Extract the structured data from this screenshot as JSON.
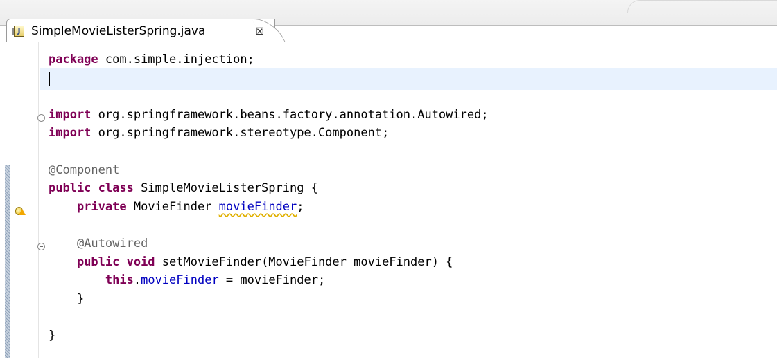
{
  "tab": {
    "file_icon_letter": "J",
    "label": "SimpleMovieListerSpring.java",
    "close_glyph": "⊠"
  },
  "editor": {
    "lines": [
      "package com.simple.injection;",
      "",
      "",
      "import org.springframework.beans.factory.annotation.Autowired;",
      "import org.springframework.stereotype.Component;",
      "",
      "@Component",
      "public class SimpleMovieListerSpring {",
      "    private MovieFinder movieFinder;",
      "",
      "    @Autowired",
      "    public void setMovieFinder(MovieFinder movieFinder) {",
      "        this.movieFinder = movieFinder;",
      "    }",
      "",
      "}"
    ],
    "warning_line": 9
  },
  "icons": {
    "file": "java-file-icon",
    "close": "close-icon",
    "fold": "fold-collapse-icon",
    "warning": "warning-icon"
  },
  "colors": {
    "keyword": "#7f0055",
    "annotation": "#646464",
    "field": "#0000c0",
    "current_line": "#e8f2fe"
  }
}
